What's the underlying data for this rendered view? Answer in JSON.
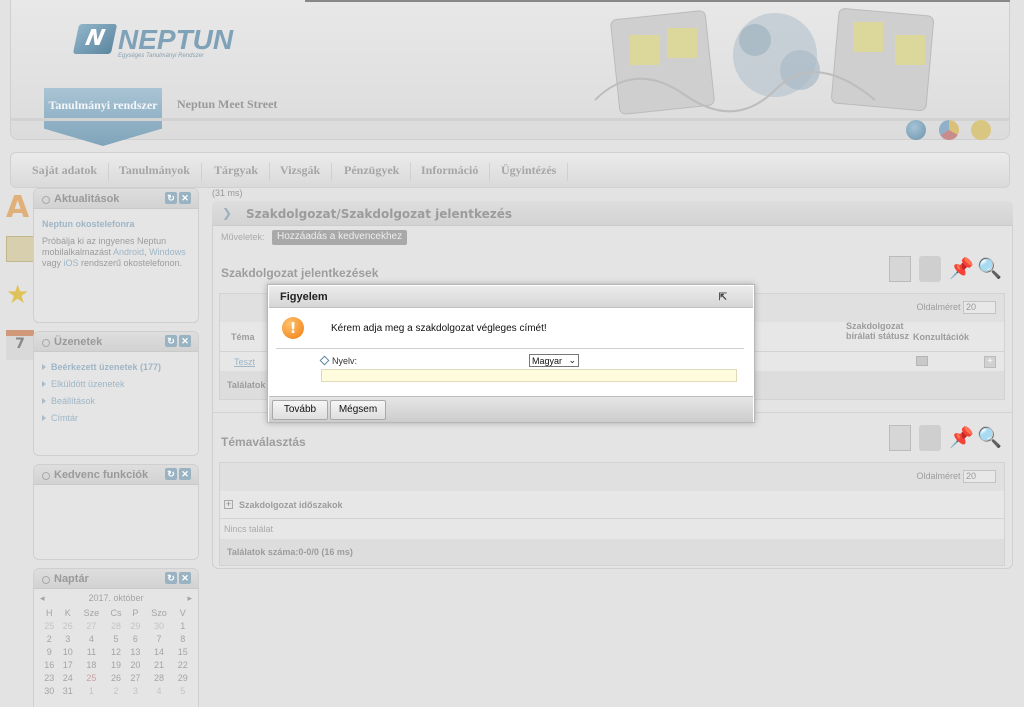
{
  "app": {
    "logo_text": "NEPTUN",
    "logo_subtitle": "Egységes Tanulmányi Rendszer",
    "tab_active": "Tanulmányi rendszer",
    "tab_other": "Neptun Meet Street"
  },
  "nav": [
    "Saját adatok",
    "Tanulmányok",
    "Tárgyak",
    "Vizsgák",
    "Pénzügyek",
    "Információ",
    "Ügyintézés"
  ],
  "panels": {
    "news": {
      "title": "Aktualitások",
      "headline": "Neptun okostelefonra",
      "text_1": "Próbálja ki az ingyenes Neptun mobilalkalmazást ",
      "android": "Android",
      "comma": ",",
      "windows": "Windows",
      "text_2": " vagy ",
      "ios": "iOS",
      "text_3": " rendszerű okostelefonon."
    },
    "messages": {
      "title": "Üzenetek",
      "items": [
        "Beérkezett üzenetek (177)",
        "Elküldött üzenetek",
        "Beállítások",
        "Címtár"
      ]
    },
    "favorites": {
      "title": "Kedvenc funkciók"
    },
    "calendar": {
      "title": "Naptár",
      "month": "2017. október",
      "prev": "◂",
      "next": "▸",
      "weekdays": [
        "H",
        "K",
        "Sze",
        "Cs",
        "P",
        "Szo",
        "V"
      ],
      "weeks": [
        [
          "25",
          "26",
          "27",
          "28",
          "29",
          "30",
          "1"
        ],
        [
          "2",
          "3",
          "4",
          "5",
          "6",
          "7",
          "8"
        ],
        [
          "9",
          "10",
          "11",
          "12",
          "13",
          "14",
          "15"
        ],
        [
          "16",
          "17",
          "18",
          "19",
          "20",
          "21",
          "22"
        ],
        [
          "23",
          "24",
          "25",
          "26",
          "27",
          "28",
          "29"
        ],
        [
          "30",
          "31",
          "1",
          "2",
          "3",
          "4",
          "5"
        ]
      ]
    }
  },
  "main": {
    "timing": "(31 ms)",
    "breadcrumb": "Szakdolgozat/Szakdolgozat jelentkezés",
    "ops_label": "Műveletek:",
    "add_fav": "Hozzáadás a kedvencekhez",
    "section1": {
      "title": "Szakdolgozat jelentkezések",
      "page_size_label": "Oldalméret",
      "page_size": "20",
      "col_topic": "Téma",
      "col_status": "Szakdolgozat bírálati státusz",
      "col_consult": "Konzultációk",
      "row_topic": "Teszt",
      "results": "Találatok"
    },
    "section2": {
      "title": "Témaválasztás",
      "page_size_label": "Oldalméret",
      "page_size": "20",
      "group": "Szakdolgozat időszakok",
      "no_result": "Nincs találat",
      "results": "Találatok száma:0-0/0 (16 ms)"
    }
  },
  "dialog": {
    "title": "Figyelem",
    "message": "Kérem adja meg a szakdolgozat végleges címét!",
    "language_label": "Nyelv:",
    "language_value": "Magyar",
    "next_button": "Tovább",
    "cancel_button": "Mégsem"
  }
}
